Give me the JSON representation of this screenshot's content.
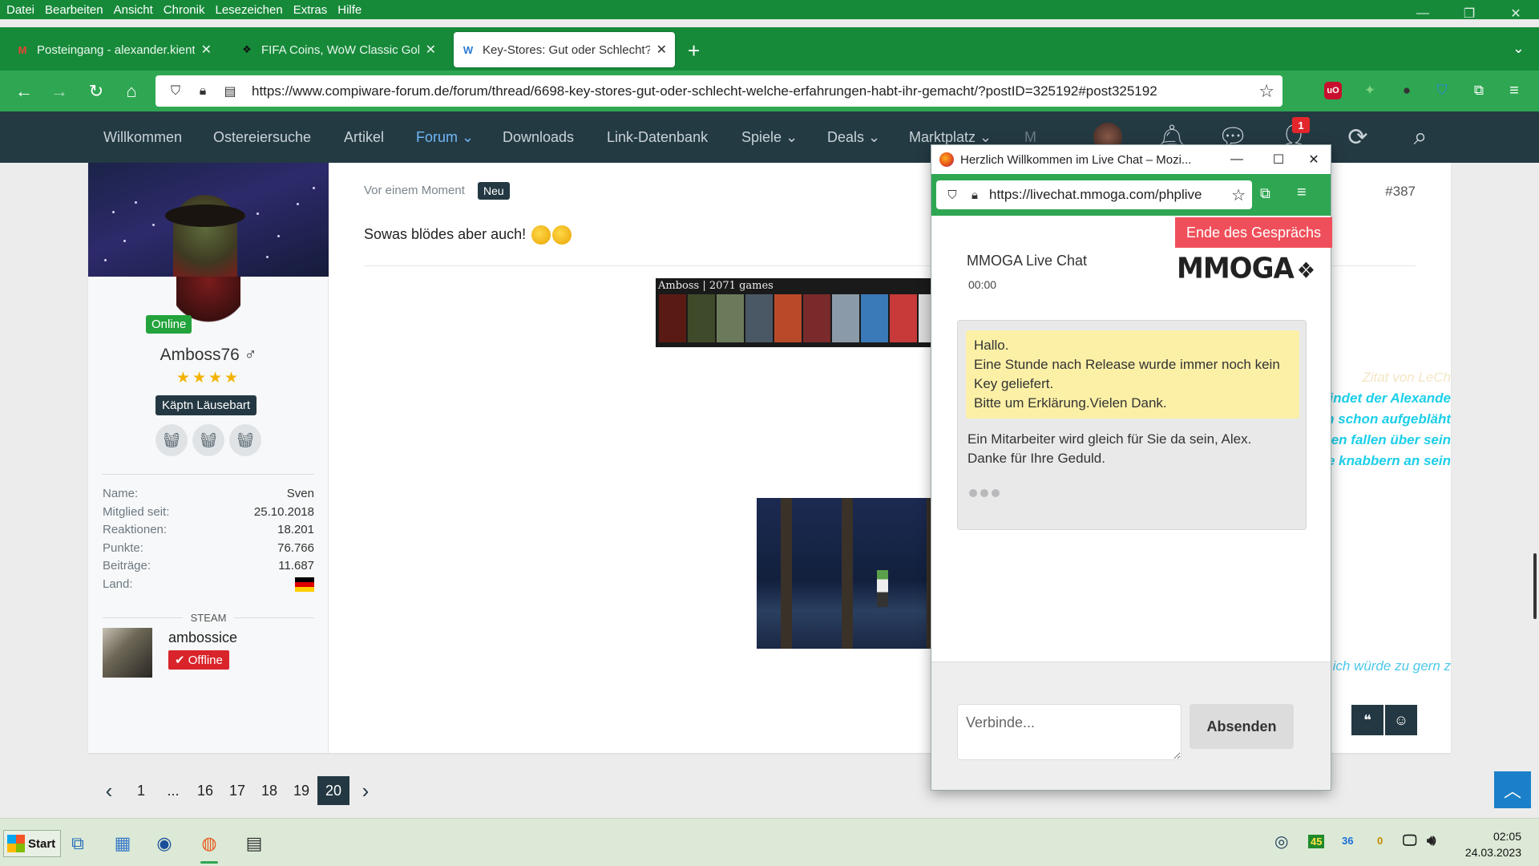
{
  "menubar": [
    "Datei",
    "Bearbeiten",
    "Ansicht",
    "Chronik",
    "Lesezeichen",
    "Extras",
    "Hilfe"
  ],
  "tabs": [
    {
      "title": "Posteingang - alexander.kientz",
      "icon": "gmail-icon"
    },
    {
      "title": "FIFA Coins, WoW Classic Gold, C",
      "icon": "mmoga-icon"
    },
    {
      "title": "Key-Stores: Gut oder Schlecht? W",
      "icon": "compiware-icon"
    }
  ],
  "address": {
    "url": "https://www.compiware-forum.de/forum/thread/6698-key-stores-gut-oder-schlecht-welche-erfahrungen-habt-ihr-gemacht/?postID=325192#post325192"
  },
  "sitenav": {
    "items": [
      "Willkommen",
      "Ostereiersuche",
      "Artikel",
      "Forum",
      "Downloads",
      "Link-Datenbank",
      "Spiele",
      "Deals",
      "Marktplatz",
      "M"
    ],
    "dropdown_marker": "⌄",
    "notification_count": "1"
  },
  "profile": {
    "online": "Online",
    "username": "Amboss76 ♂",
    "stars": "★★★★",
    "rank": "Käptn Läusebart",
    "stats": [
      {
        "k": "Name:",
        "v": "Sven"
      },
      {
        "k": "Mitglied seit:",
        "v": "25.10.2018"
      },
      {
        "k": "Reaktionen:",
        "v": "18.201"
      },
      {
        "k": "Punkte:",
        "v": "76.766"
      },
      {
        "k": "Beiträge:",
        "v": "11.687"
      },
      {
        "k": "Land:",
        "v": ""
      }
    ],
    "steam_heading": "STEAM",
    "steam_name": "ambossice",
    "steam_status": "Offline"
  },
  "post": {
    "time": "Vor einem Moment",
    "new_badge": "Neu",
    "number": "#387",
    "text": "Sowas blödes aber auch!",
    "signature_banner": "Amboss | 2071 games",
    "quote_author": "Zitat von LeCh",
    "quote_lines": [
      "Just diesen Augenblick befindet der Alexande",
      "Wahrscheinlich schon aufgebläht",
      "Krabben fallen über sein",
      "Fische knabbern an sein"
    ],
    "caption": "Hach, ich würde zu gern z"
  },
  "pagination": {
    "pages": [
      "1",
      "...",
      "16",
      "17",
      "18",
      "19",
      "20"
    ],
    "current": "20"
  },
  "popup": {
    "window_title": "Herzlich Willkommen im Live Chat – Mozi...",
    "url": "https://livechat.mmoga.com/phplive",
    "end_chat": "Ende des Gesprächs",
    "chat_title": "MMOGA Live Chat",
    "timer": "00:00",
    "logo_text": "MMOGA",
    "user_message": [
      "Hallo.",
      "Eine Stunde nach Release wurde immer noch kein Key geliefert.",
      "Bitte um Erklärung.Vielen Dank."
    ],
    "agent_message": [
      "Ein Mitarbeiter wird gleich für Sie da sein, Alex.",
      "Danke für Ihre Geduld."
    ],
    "input_placeholder": "Verbinde...",
    "send_label": "Absenden"
  },
  "taskbar": {
    "start_label": "Start",
    "tray": {
      "a": "36",
      "b": "0"
    },
    "time": "02:05",
    "date": "24.03.2023"
  },
  "colors": {
    "browser_green": "#2fa752",
    "site_nav": "#243a43",
    "quote_cyan": "#1ccfe9",
    "end_chat_red": "#ef4f5a"
  }
}
